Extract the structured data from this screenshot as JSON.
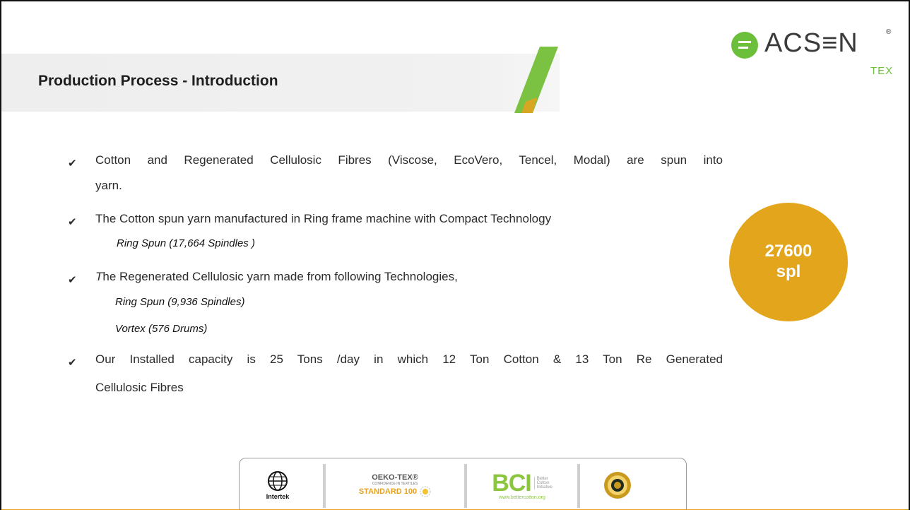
{
  "title": "Production Process - Introduction",
  "logo": {
    "text": "ACS≡N",
    "sub": "TEX",
    "reg": "®"
  },
  "bullets": [
    {
      "text_line1": "Cotton and Regenerated Cellulosic Fibres (Viscose, EcoVero, Tencel, Modal) are spun into",
      "text_line2": "yarn."
    },
    {
      "text": "The Cotton spun yarn manufactured in Ring frame machine with Compact  Technology",
      "sub": [
        "Ring Spun (17,664 Spindles )"
      ]
    },
    {
      "text_italic_first": "T",
      "text": "he Regenerated Cellulosic yarn made from following Technologies,",
      "sub": [
        "Ring Spun  (9,936 Spindles)",
        "Vortex  (576 Drums)"
      ]
    },
    {
      "text_line1": "Our Installed capacity is 25 Tons /day in which 12 Ton Cotton & 13 Ton Re Generated",
      "text_line2": "Cellulosic Fibres"
    }
  ],
  "check_symbol": "✔",
  "badge": {
    "line1": "27600",
    "line2": "spl"
  },
  "certifications": {
    "intertek": "Intertek",
    "oeko": {
      "brand": "OEKO-TEX®",
      "tagline": "CONFIDENCE IN TEXTILES",
      "standard": "STANDARD 100"
    },
    "bci": {
      "logo": "BCI",
      "line1": "Better",
      "line2": "Cotton",
      "line3": "Initiative",
      "url": "www.bettercotton.org"
    }
  },
  "colors": {
    "accent": "#e2a51c",
    "green": "#6cbf3a",
    "orange": "#e8a21b"
  }
}
